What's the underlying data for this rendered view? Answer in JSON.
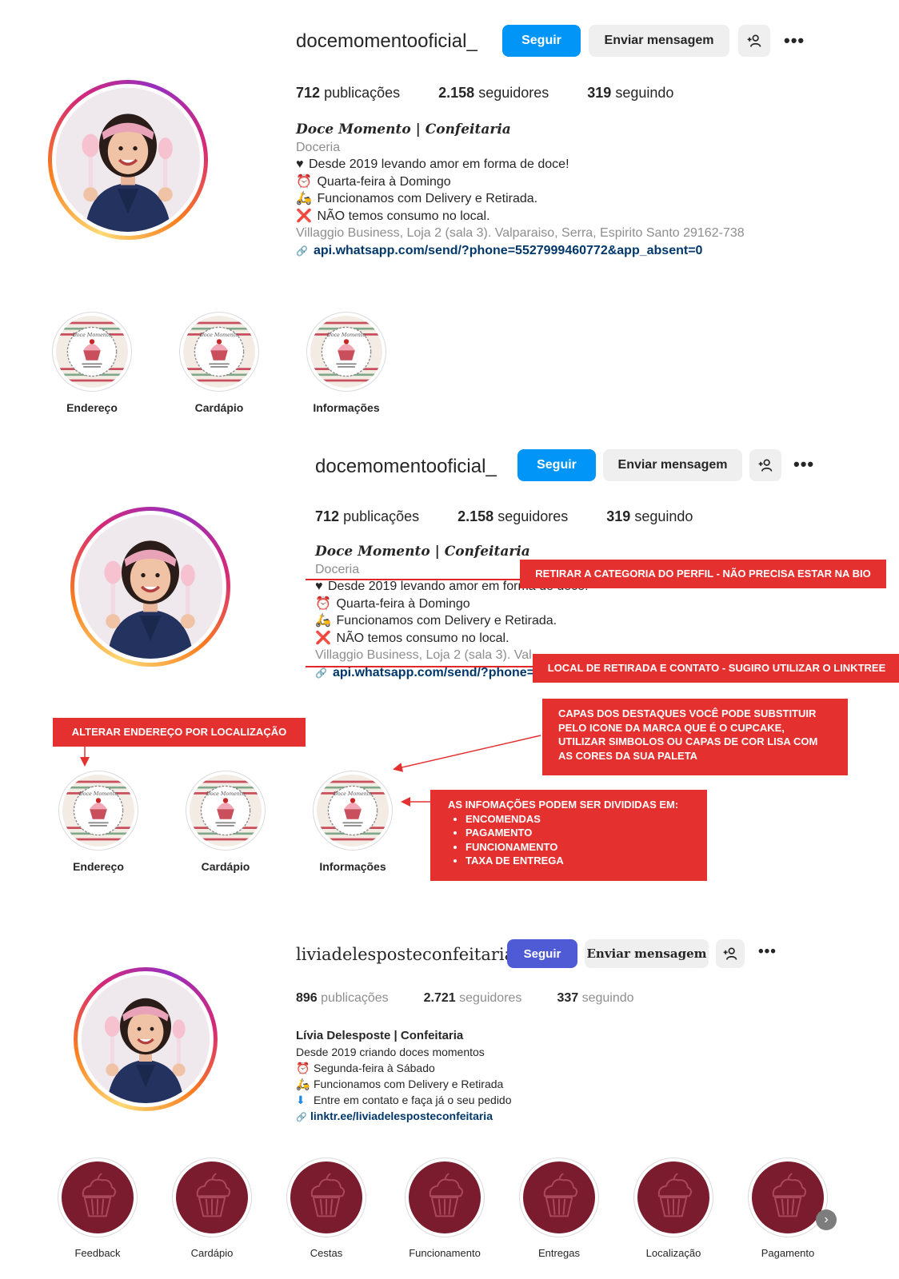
{
  "profile_a": {
    "username": "docemomentooficial_",
    "follow_label": "Seguir",
    "message_label": "Enviar mensagem",
    "more_label": "•••",
    "stats": {
      "posts_count": "712",
      "posts_label": "publicações",
      "followers_count": "2.158",
      "followers_label": "seguidores",
      "following_count": "319",
      "following_label": "seguindo"
    },
    "bio": {
      "name": "Doce Momento | Confeitaria",
      "category": "Doceria",
      "line1_icon": "♥",
      "line1": "Desde 2019 levando amor em forma de doce!",
      "line2_icon": "⏰",
      "line2": "Quarta-feira à Domingo",
      "line3_icon": "🛵",
      "line3": "Funcionamos com Delivery e Retirada.",
      "line4_icon": "❌",
      "line4": "NÃO temos consumo no local.",
      "address": "Villaggio Business, Loja 2 (sala 3). Valparaiso, Serra, Espirito Santo 29162-738",
      "link_icon": "🔗",
      "link": "api.whatsapp.com/send/?phone=5527999460772&app_absent=0"
    },
    "highlights": [
      {
        "label": "Endereço"
      },
      {
        "label": "Cardápio"
      },
      {
        "label": "Informações"
      }
    ]
  },
  "annotations": {
    "category_note": "RETIRAR A CATEGORIA DO PERFIL - NÃO PRECISA ESTAR NA BIO",
    "contact_note": "LOCAL DE RETIRADA E CONTATO - SUGIRO UTILIZAR O LINKTREE",
    "address_note": "ALTERAR ENDEREÇO POR LOCALIZAÇÃO",
    "covers_note": "CAPAS DOS DESTAQUES VOCÊ PODE SUBSTITUIR PELO ICONE DA MARCA QUE É O CUPCAKE, UTILIZAR SIMBOLOS OU CAPAS DE COR LISA COM AS CORES DA SUA PALETA",
    "info_note_title": "AS INFOMAÇÕES PODEM SER DIVIDIDAS EM:",
    "info_note_items": [
      "ENCOMENDAS",
      "PAGAMENTO",
      "FUNCIONAMENTO",
      "TAXA DE ENTREGA"
    ],
    "accent_color": "#e53030"
  },
  "profile_b": {
    "username": "liviadelesposteconfeitaria",
    "follow_label": "Seguir",
    "message_label": "Enviar mensagem",
    "more_label": "•••",
    "stats": {
      "posts_count": "896",
      "posts_label": "publicações",
      "followers_count": "2.721",
      "followers_label": "seguidores",
      "following_count": "337",
      "following_label": "seguindo"
    },
    "bio": {
      "name": "Lívia Delesposte | Confeitaria",
      "line1": "Desde 2019 criando doces momentos",
      "line2_icon": "⏰",
      "line2": "Segunda-feira à Sábado",
      "line3_icon": "🛵",
      "line3": "Funcionamos com Delivery e Retirada",
      "line4_icon": "⬇",
      "line4": "Entre em contato e faça já o seu pedido",
      "link_icon": "🔗",
      "link": "linktr.ee/liviadelesposteconfeitaria"
    },
    "highlights": [
      {
        "label": "Feedback"
      },
      {
        "label": "Cardápio"
      },
      {
        "label": "Cestas"
      },
      {
        "label": "Funcionamento"
      },
      {
        "label": "Entregas"
      },
      {
        "label": "Localização"
      },
      {
        "label": "Pagamento"
      }
    ],
    "highlight_color": "#7b1c2e",
    "next_arrow": "›"
  },
  "colors": {
    "follow_blue": "#0095f6",
    "follow_purple": "#4f5bd5",
    "link_blue": "#00376b"
  }
}
